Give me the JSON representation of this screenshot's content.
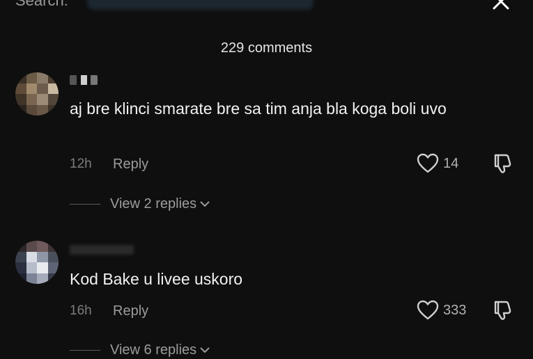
{
  "header": {
    "search_label": "Search:",
    "comments_count": "229 comments"
  },
  "comments": [
    {
      "text": "aj bre klinci smarate bre sa tim anja bla koga boli uvo",
      "time": "12h",
      "reply_label": "Reply",
      "likes": "14",
      "view_replies": "View 2 replies"
    },
    {
      "text": "Kod Bake u livee uskoro",
      "time": "16h",
      "reply_label": "Reply",
      "likes": "333",
      "view_replies": "View 6 replies"
    }
  ],
  "icons": {
    "close": "close-icon",
    "like": "heart-outline-icon",
    "dislike": "thumbs-down-icon",
    "expand": "chevron-down-icon"
  }
}
